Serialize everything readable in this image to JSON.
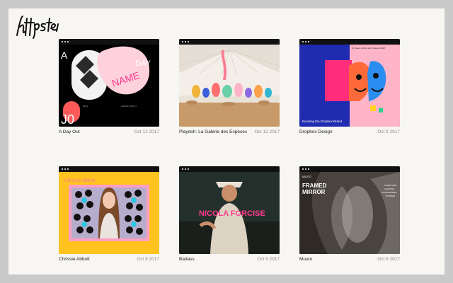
{
  "site": {
    "logo_text": "httpster"
  },
  "cards": [
    {
      "title": "A Day Out",
      "date": "Oct 12 2017",
      "shot_text": {
        "left": "A",
        "right": "DAY",
        "bottom": "J0",
        "pill": "NAME",
        "caption_left": "MON",
        "caption_right": "SUNDAY MAY 3"
      }
    },
    {
      "title": "Playdoh: La Galerie des Espèces",
      "date": "Oct 12 2017",
      "shot_text": {}
    },
    {
      "title": "Dropbox Design",
      "date": "Oct 9 2017",
      "shot_text": {
        "header": "By Jason Hobbs and Yaleeka Wolff",
        "caption": "Evolving the Dropbox Brand"
      }
    },
    {
      "title": "Chrissie Abbott",
      "date": "Oct 9 2017",
      "shot_text": {
        "banner": "Chrissie Abbott"
      }
    },
    {
      "title": "Badass",
      "date": "Oct 9 2017",
      "shot_text": {
        "headline": "NICOLA FORCISE"
      }
    },
    {
      "title": "Muuto",
      "date": "Oct 6 2017",
      "shot_text": {
        "brand": "MUUTO",
        "headline_1": "FRAMED",
        "headline_2": "MIRROR",
        "menu": [
          "FURNITURE",
          "LIGHTING",
          "ACCESSORIES",
          "STORIES"
        ]
      }
    }
  ],
  "colors": {
    "page_bg": "#f7f6f3",
    "frame_bg": "#c9c9c9",
    "pink": "#ff3b8d",
    "blue": "#1f2bb0",
    "yellow": "#ffc21e",
    "cyan": "#2ec6dd"
  },
  "icons": [
    "window-dot-icon"
  ]
}
